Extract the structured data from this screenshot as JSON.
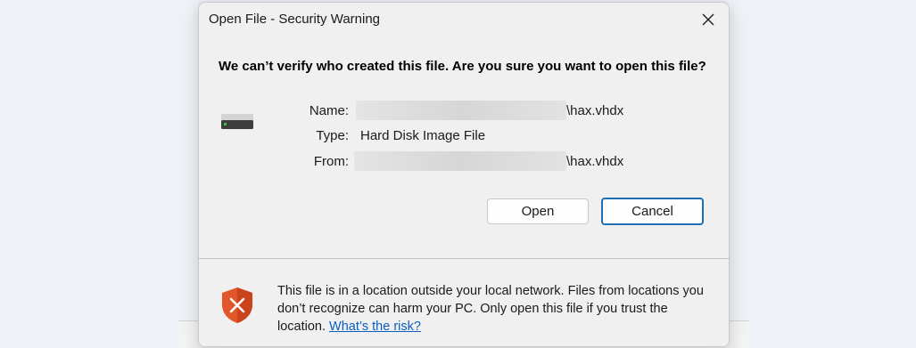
{
  "dialog": {
    "title": "Open File - Security Warning",
    "heading": "We can’t verify who created this file. Are you sure you want to open this file?",
    "fields": {
      "name_label": "Name:",
      "name_value": "\\hax.vhdx",
      "type_label": "Type:",
      "type_value": "Hard Disk Image File",
      "from_label": "From:",
      "from_value": "\\hax.vhdx"
    },
    "buttons": {
      "open": "Open",
      "cancel": "Cancel"
    },
    "footer": {
      "message": "This file is in a location outside your local network. Files from locations you don’t recognize can harm your PC. Only open this file if you trust the location.",
      "link": "What’s the risk?"
    }
  },
  "icons": {
    "close": "close-icon",
    "file": "hard-disk-icon",
    "warning": "shield-warning-icon"
  },
  "colors": {
    "accent": "#1f6fb5",
    "link": "#0b5fc2",
    "shield": "#e2562b",
    "dialog_bg": "#f0f0f0"
  }
}
